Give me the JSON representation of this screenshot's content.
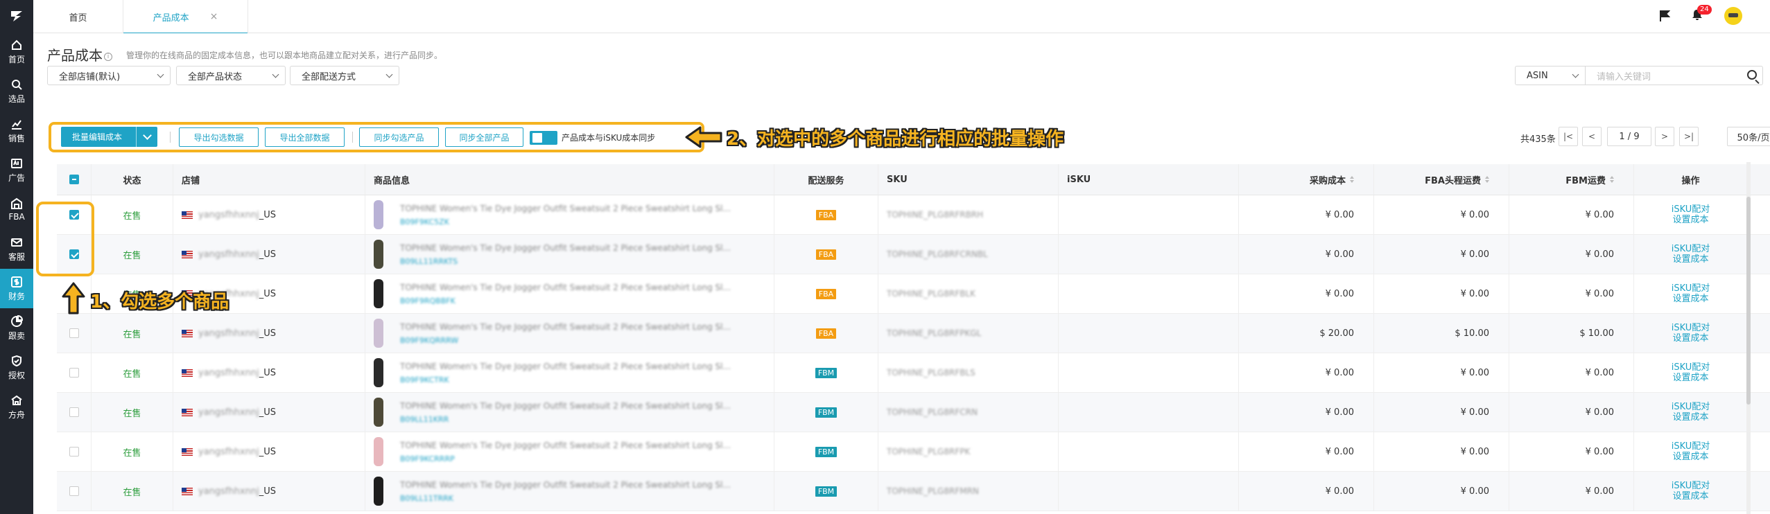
{
  "sidebar": {
    "items": [
      {
        "label": "首页",
        "icon": "home-icon"
      },
      {
        "label": "选品",
        "icon": "search-icon"
      },
      {
        "label": "销售",
        "icon": "chart-icon"
      },
      {
        "label": "广告",
        "icon": "ad-icon"
      },
      {
        "label": "FBA",
        "icon": "warehouse-icon"
      },
      {
        "label": "客服",
        "icon": "mail-icon"
      },
      {
        "label": "财务",
        "icon": "finance-icon"
      },
      {
        "label": "跟卖",
        "icon": "pie-icon"
      },
      {
        "label": "授权",
        "icon": "shield-icon"
      },
      {
        "label": "方舟",
        "icon": "ark-icon"
      }
    ]
  },
  "tabs": {
    "home": "首页",
    "product_cost": "产品成本",
    "close": "×"
  },
  "notifications": {
    "count": "24"
  },
  "page": {
    "title": "产品成本",
    "info": "i",
    "description": "管理你的在线商品的固定成本信息，也可以跟本地商品建立配对关系，进行产品同步。"
  },
  "filters": {
    "store": "全部店铺(默认)",
    "product_status": "全部产品状态",
    "delivery": "全部配送方式",
    "search_type": "ASIN",
    "search_placeholder": "请输入关键词"
  },
  "toolbar": {
    "batch_edit": "批量编辑成本",
    "export_selected": "导出勾选数据",
    "export_all": "导出全部数据",
    "sync_selected": "同步勾选产品",
    "sync_all": "同步全部产品",
    "sync_toggle_label": "产品成本与iSKU成本同步"
  },
  "annotations": {
    "step1": "1、勾选多个商品",
    "step2": "2、对选中的多个商品进行相应的批量操作"
  },
  "pagination": {
    "total": "共435条",
    "first": "|<",
    "prev": "<",
    "page": "1 / 9",
    "next": ">",
    "last": ">|",
    "per_page": "50条/页"
  },
  "table": {
    "headers": {
      "status": "状态",
      "store": "店铺",
      "product": "商品信息",
      "delivery": "配送服务",
      "sku": "SKU",
      "isku": "iSKU",
      "purchase_cost": "采购成本",
      "fba_freight": "FBA头程运费",
      "fbm_freight": "FBM运费",
      "actions": "操作"
    },
    "rows": [
      {
        "checked": true,
        "status": "在售",
        "store_blur": "yangsfhhxnnj",
        "store_suffix": "_US",
        "title": "TOPHINE Women's Tie Dye Jogger Outfit Sweatsuit 2 Piece Sweatshirt Long Sl...",
        "asin": "B09F9KC5ZK",
        "delivery": "FBA",
        "sku": "TOPHINE_PLG8RFRBRH",
        "purchase_cost": "¥ 0.00",
        "fba_freight": "¥ 0.00",
        "fbm_freight": "¥ 0.00",
        "action1": "iSKU配对",
        "action2": "设置成本",
        "thumb": "#b9b2d6"
      },
      {
        "checked": true,
        "status": "在售",
        "store_blur": "yangsfhhxnnj",
        "store_suffix": "_US",
        "title": "TOPHINE Women's Tie Dye Jogger Outfit Sweatsuit 2 Piece Sweatshirt Long Sl...",
        "asin": "B09LL11RRKTS",
        "delivery": "FBA",
        "sku": "TOPHINE_PLG8RFCRNBL",
        "purchase_cost": "¥ 0.00",
        "fba_freight": "¥ 0.00",
        "fbm_freight": "¥ 0.00",
        "action1": "iSKU配对",
        "action2": "设置成本",
        "thumb": "#4a4a3a"
      },
      {
        "checked": false,
        "status": "在售",
        "store_blur": "yangsfhhxnnj",
        "store_suffix": "_US",
        "title": "TOPHINE Women's Tie Dye Jogger Outfit Sweatsuit 2 Piece Sweatshirt Long Sl...",
        "asin": "B09F9RQBBFK",
        "delivery": "FBA",
        "sku": "TOPHINE_PLG8RFBLK",
        "purchase_cost": "¥ 0.00",
        "fba_freight": "¥ 0.00",
        "fbm_freight": "¥ 0.00",
        "action1": "iSKU配对",
        "action2": "设置成本",
        "thumb": "#222222"
      },
      {
        "checked": false,
        "status": "在售",
        "store_blur": "yangsfhhxnnj",
        "store_suffix": "_US",
        "title": "TOPHINE Women's Tie Dye Jogger Outfit Sweatsuit 2 Piece Sweatshirt Long Sl...",
        "asin": "B09F9KQRRRW",
        "delivery": "FBA",
        "sku": "TOPHINE_PLG8RFPKGL",
        "purchase_cost": "$ 20.00",
        "fba_freight": "$ 10.00",
        "fbm_freight": "$ 10.00",
        "action1": "iSKU配对",
        "action2": "设置成本",
        "thumb": "#cdbfd4"
      },
      {
        "checked": false,
        "status": "在售",
        "store_blur": "yangsfhhxnnj",
        "store_suffix": "_US",
        "title": "TOPHINE Women's Tie Dye Jogger Outfit Sweatsuit 2 Piece Sweatshirt Long Sl...",
        "asin": "B09F9KCTRK",
        "delivery": "FBM",
        "sku": "TOPHINE_PLG8RFBLS",
        "purchase_cost": "¥ 0.00",
        "fba_freight": "¥ 0.00",
        "fbm_freight": "¥ 0.00",
        "action1": "iSKU配对",
        "action2": "设置成本",
        "thumb": "#2a2a2a"
      },
      {
        "checked": false,
        "status": "在售",
        "store_blur": "yangsfhhxnnj",
        "store_suffix": "_US",
        "title": "TOPHINE Women's Tie Dye Jogger Outfit Sweatsuit 2 Piece Sweatshirt Long Sl...",
        "asin": "B09LL11KRR",
        "delivery": "FBM",
        "sku": "TOPHINE_PLG8RFCRN",
        "purchase_cost": "¥ 0.00",
        "fba_freight": "¥ 0.00",
        "fbm_freight": "¥ 0.00",
        "action1": "iSKU配对",
        "action2": "设置成本",
        "thumb": "#4e4a38"
      },
      {
        "checked": false,
        "status": "在售",
        "store_blur": "yangsfhhxnnj",
        "store_suffix": "_US",
        "title": "TOPHINE Women's Tie Dye Jogger Outfit Sweatsuit 2 Piece Sweatshirt Long Sl...",
        "asin": "B09F9KCRRRP",
        "delivery": "FBM",
        "sku": "TOPHINE_PLG8RFPK",
        "purchase_cost": "¥ 0.00",
        "fba_freight": "¥ 0.00",
        "fbm_freight": "¥ 0.00",
        "action1": "iSKU配对",
        "action2": "设置成本",
        "thumb": "#e8b7bd"
      },
      {
        "checked": false,
        "status": "在售",
        "store_blur": "yangsfhhxnnj",
        "store_suffix": "_US",
        "title": "TOPHINE Women's Tie Dye Jogger Outfit Sweatsuit 2 Piece Sweatshirt Long Sl...",
        "asin": "B09LL11TRRK",
        "delivery": "FBM",
        "sku": "TOPHINE_PLG8RFMRN",
        "purchase_cost": "¥ 0.00",
        "fba_freight": "¥ 0.00",
        "fbm_freight": "¥ 0.00",
        "action1": "iSKU配对",
        "action2": "设置成本",
        "thumb": "#1e1e1e"
      }
    ]
  },
  "colors": {
    "accent": "#1fa3c6",
    "annotation": "#f5b320",
    "sidebar": "#22262e",
    "status_green": "#2e9e3e",
    "fba_tag": "#f39c12",
    "fbm_tag": "#1a9bb0"
  }
}
